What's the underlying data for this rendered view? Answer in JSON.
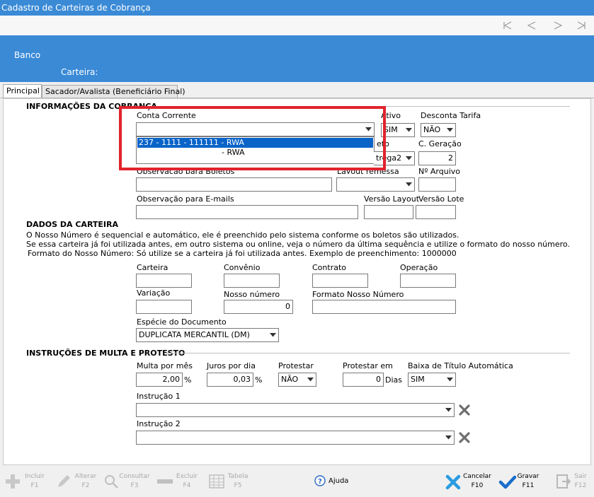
{
  "window": {
    "title": "Cadastro de Carteiras de Cobrança"
  },
  "header": {
    "banco_label": "Banco",
    "carteira_label": "Carteira:"
  },
  "tabs": [
    {
      "label": "Principal"
    },
    {
      "label": "Sacador/Avalista (Beneficiário Final)"
    }
  ],
  "info": {
    "section_title": "INFORMAÇÕES DA COBRANÇA",
    "conta_corrente_label": "Conta Corrente",
    "conta_corrente_value": "",
    "conta_options": [
      "237 - 1111 - 111111 - RWA",
      "- RWA"
    ],
    "ativo_label": "Ativo",
    "ativo_value": "SIM",
    "desconta_tarifa_label": "Desconta Tarifa",
    "desconta_tarifa_value": "NÃO",
    "tipo_boleto_label_fragment": "eto",
    "tipo_boleto_value_fragment": "trega2",
    "c_geracao_label": "C. Geração",
    "c_geracao_value": "2",
    "obs_boletos_label": "Observação para Boletos",
    "obs_boletos_value": "",
    "layout_remessa_label": "Layout remessa",
    "layout_remessa_value": "",
    "num_arquivo_label": "Nº Arquivo",
    "num_arquivo_value": "",
    "obs_emails_label": "Observação para E-mails",
    "obs_emails_value": "",
    "versao_layout_label": "Versão Layout",
    "versao_layout_value": "",
    "versao_lote_label": "Versão Lote",
    "versao_lote_value": ""
  },
  "carteira": {
    "section_title": "DADOS DA CARTEIRA",
    "note1": "O Nosso Número é sequencial e automático, ele é preenchido pelo sistema conforme os boletos são utilizados.",
    "note2": "Se essa carteira já foi utilizada antes, em outro sistema ou online, veja o número da última sequência e utilize o formato do nosso número.",
    "note3": "Formato do Nosso Número: Só utilize se a carteira já foi utilizada antes. Exemplo de preenchimento: 1000000",
    "carteira_label": "Carteira",
    "carteira_value": "",
    "convenio_label": "Convênio",
    "convenio_value": "",
    "contrato_label": "Contrato",
    "contrato_value": "",
    "operacao_label": "Operação",
    "operacao_value": "",
    "variacao_label": "Variação",
    "variacao_value": "",
    "nosso_numero_label": "Nosso número",
    "nosso_numero_value": "0",
    "formato_nosso_numero_label": "Formato Nosso Número",
    "formato_nosso_numero_value": "",
    "especie_label": "Espécie do Documento",
    "especie_value": "DUPLICATA MERCANTIL (DM)"
  },
  "multa": {
    "section_title": "INSTRUÇÕES DE MULTA E PROTESTO",
    "multa_label": "Multa por mês",
    "multa_value": "2,00",
    "multa_unit": "%",
    "juros_label": "Juros por dia",
    "juros_value": "0,03",
    "juros_unit": "%",
    "protestar_label": "Protestar",
    "protestar_value": "NÃO",
    "protestar_em_label": "Protestar em",
    "protestar_em_value": "0",
    "protestar_em_unit": "Dias",
    "baixa_label": "Baixa de Título Automática",
    "baixa_value": "SIM",
    "instrucao1_label": "Instrução 1",
    "instrucao1_value": "",
    "instrucao2_label": "Instrução 2",
    "instrucao2_value": ""
  },
  "toolbar": {
    "incluir": {
      "label": "Incluir",
      "key": "F1"
    },
    "alterar": {
      "label": "Alterar",
      "key": "F2"
    },
    "consultar": {
      "label": "Consultar",
      "key": "F3"
    },
    "excluir": {
      "label": "Excluir",
      "key": "F4"
    },
    "tabela": {
      "label": "Tabela",
      "key": "F5"
    },
    "ajuda": {
      "label": "Ajuda"
    },
    "cancelar": {
      "label": "Cancelar",
      "key": "F10"
    },
    "gravar": {
      "label": "Gravar",
      "key": "F11"
    },
    "sair": {
      "label": "Sair",
      "key": "F12"
    }
  },
  "colors": {
    "header_blue": "#3a8ad6",
    "selection_blue": "#0a64c8",
    "highlight_red": "#e1232d",
    "cancel_blue": "#2a9be0",
    "save_blue": "#1a6cc9"
  }
}
